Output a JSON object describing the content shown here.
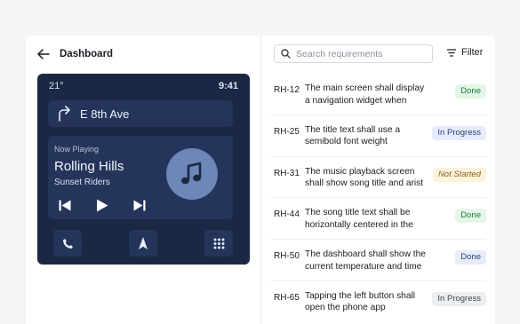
{
  "header": {
    "title": "Dashboard"
  },
  "car_screen": {
    "temperature": "21°",
    "time": "9:41",
    "navigation": {
      "street": "E 8th Ave",
      "icon": "turn-right-arrow-icon"
    },
    "media": {
      "now_playing_label": "Now Playing",
      "song_title": "Rolling Hills",
      "artist": "Sunset Riders",
      "album_icon": "music-note-icon",
      "controls": [
        "skip-back-icon",
        "play-icon",
        "skip-forward-icon"
      ]
    },
    "dock": [
      "phone-icon",
      "navigation-arrow-icon",
      "app-grid-icon"
    ]
  },
  "search": {
    "placeholder": "Search requirements",
    "value": ""
  },
  "filter": {
    "label": "Filter"
  },
  "requirements": [
    {
      "id": "RH-12",
      "text": "The main screen shall display a navigation widget when acti...",
      "status": "Done"
    },
    {
      "id": "RH-25",
      "text": "The title text shall use a semibold font weight",
      "status": "In Progress"
    },
    {
      "id": "RH-31",
      "text": "The music playback screen shall show song title and arist",
      "status": "Not Started"
    },
    {
      "id": "RH-44",
      "text": "The song title text shall be horizontally centered in the widgt",
      "status": "Done"
    },
    {
      "id": "RH-50",
      "text": "The dashboard shall show the current temperature and time",
      "status": "Done"
    },
    {
      "id": "RH-65",
      "text": "Tapping the left button shall open the phone app",
      "status": "In Progress"
    }
  ],
  "colors": {
    "car_background": "#1b2844",
    "car_card": "#24345a",
    "album_art": "#6d87b8",
    "done_badge": "#e3f6e8",
    "in_progress_badge": "#e6ecfb",
    "not_started_badge": "#fdf3dc"
  }
}
